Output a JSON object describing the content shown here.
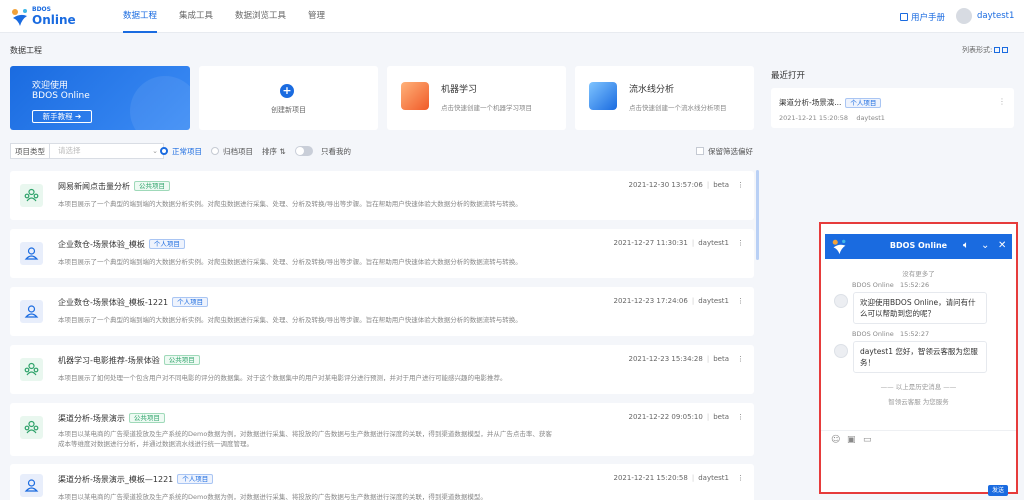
{
  "brand": {
    "sub": "BDOS",
    "main": "Online"
  },
  "nav": [
    "数据工程",
    "集成工具",
    "数据浏览工具",
    "管理"
  ],
  "header": {
    "manual": "用户手册",
    "username": "daytest1"
  },
  "page": {
    "title": "数据工程",
    "list_format": "列表形式:"
  },
  "welcome": {
    "line1": "欢迎使用",
    "line2": "BDOS Online",
    "button": "新手教程 ➔"
  },
  "create": {
    "label": "创建新项目"
  },
  "features": [
    {
      "title": "机器学习",
      "desc": "点击快速创建一个机器学习项目"
    },
    {
      "title": "流水线分析",
      "desc": "点击快速创建一个流水线分析项目"
    }
  ],
  "filter": {
    "type_label": "项目类型",
    "select_placeholder": "请选择",
    "normal": "正常项目",
    "archived": "归档项目",
    "sort": "排序 ⇅",
    "only_mine": "只看我的",
    "keep_pref": "保留筛选偏好"
  },
  "projects": [
    {
      "name": "网易新闻点击量分析",
      "tag": "公共项目",
      "kind": "pub",
      "time": "2021-12-30 13:57:06",
      "owner": "beta",
      "desc": "本项目展示了一个典型的端到端的大数据分析实例。对爬虫数据进行采集、处理、分析及转换/导出等步骤。旨在帮助用户快速体验大数据分析的数据流转与转换。"
    },
    {
      "name": "企业数仓-场景体验_模板",
      "tag": "个人项目",
      "kind": "pri",
      "time": "2021-12-27 11:30:31",
      "owner": "daytest1",
      "desc": "本项目展示了一个典型的端到端的大数据分析实例。对爬虫数据进行采集、处理、分析及转换/导出等步骤。旨在帮助用户快速体验大数据分析的数据流转与转换。"
    },
    {
      "name": "企业数仓-场景体验_模板-1221",
      "tag": "个人项目",
      "kind": "pri",
      "time": "2021-12-23 17:24:06",
      "owner": "daytest1",
      "desc": "本项目展示了一个典型的端到端的大数据分析实例。对爬虫数据进行采集、处理、分析及转换/导出等步骤。旨在帮助用户快速体验大数据分析的数据流转与转换。"
    },
    {
      "name": "机器学习-电影推荐-场景体验",
      "tag": "公共项目",
      "kind": "pub",
      "time": "2021-12-23 15:34:28",
      "owner": "beta",
      "desc": "本项目展示了如何处理一个包含用户对不同电影的评分的数据集。对于这个数据集中的用户对某电影评分进行预测，并对于用户进行可能感兴趣的电影推荐。"
    },
    {
      "name": "渠道分析-场景演示",
      "tag": "公共项目",
      "kind": "pub",
      "time": "2021-12-22 09:05:10",
      "owner": "beta",
      "desc": "本项目以某电商的广告渠道投放及生产系统的Demo数据为例，对数据进行采集、将投放的广告数据与生产数据进行深度的关联，得到渠道数据模型，并从广告点击率、获客成本等维度对数据进行分析，并通过数据流水线进行统一调度管理。"
    },
    {
      "name": "渠道分析-场景演示_模板—1221",
      "tag": "个人项目",
      "kind": "pri",
      "time": "2021-12-21 15:20:58",
      "owner": "daytest1",
      "desc": "本项目以某电商的广告渠道投放及生产系统的Demo数据为例，对数据进行采集、将投放的广告数据与生产数据进行深度的关联，得到渠道数据模型。"
    }
  ],
  "recent": {
    "title": "最近打开",
    "item": {
      "name": "渠道分析-场景演...",
      "tag": "个人项目",
      "time": "2021-12-21 15:20:58",
      "owner": "daytest1"
    }
  },
  "chat": {
    "title": "BDOS Online",
    "no_more": "没有更多了",
    "messages": [
      {
        "sender": "BDOS Online",
        "time": "15:52:26",
        "text": "欢迎使用BDOS Online，请问有什么可以帮助到您的呢？"
      },
      {
        "sender": "BDOS Online",
        "time": "15:52:27",
        "text": "daytest1 您好，智领云客服为您服务！"
      }
    ],
    "divider": "—— 以上是历史消息 ——",
    "service": "智领云客服 为您服务",
    "send": "发送"
  },
  "colors": {
    "accent": "#1a6be0",
    "highlight_border": "#e63b3b",
    "public_tag": "#2fa36b"
  }
}
